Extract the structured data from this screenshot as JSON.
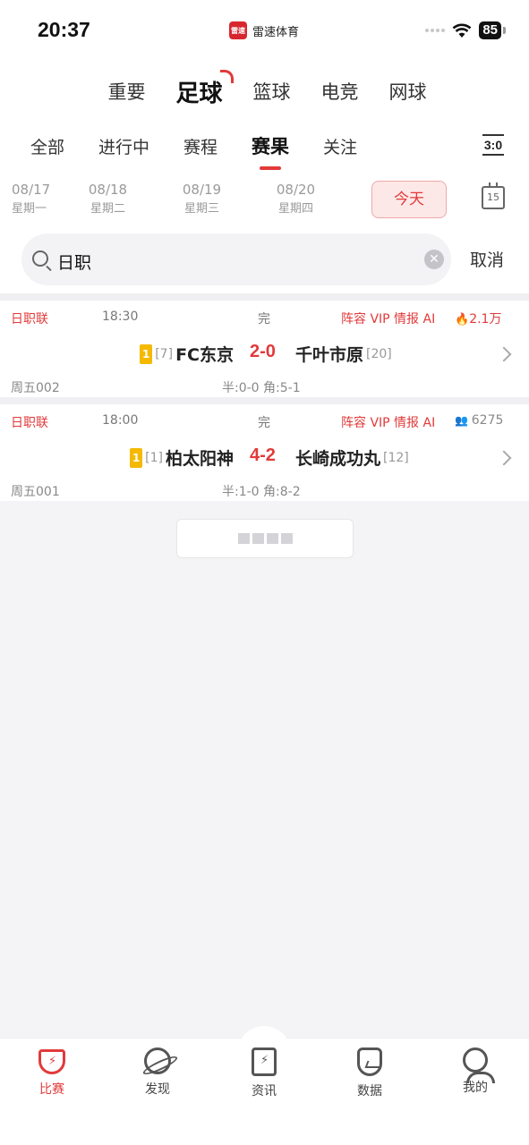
{
  "status_bar": {
    "time": "20:37",
    "app_logo_text": "雷速",
    "app_name": "雷速体育",
    "battery": "85"
  },
  "sport_tabs": [
    {
      "label": "重要"
    },
    {
      "label": "足球",
      "active": true
    },
    {
      "label": "篮球"
    },
    {
      "label": "电竞"
    },
    {
      "label": "网球"
    }
  ],
  "sub_tabs": [
    {
      "label": "全部"
    },
    {
      "label": "进行中"
    },
    {
      "label": "赛程"
    },
    {
      "label": "赛果",
      "active": true
    },
    {
      "label": "关注"
    }
  ],
  "score_icon_text": "3:0",
  "dates": [
    {
      "date": "08/17",
      "weekday": "星期一"
    },
    {
      "date": "08/18",
      "weekday": "星期二"
    },
    {
      "date": "08/19",
      "weekday": "星期三"
    },
    {
      "date": "08/20",
      "weekday": "星期四"
    }
  ],
  "today_label": "今天",
  "calendar_day": "15",
  "search": {
    "value": "日职",
    "cancel_label": "取消"
  },
  "matches": [
    {
      "league": "日职联",
      "time": "18:30",
      "status": "完",
      "info": "阵容 VIP 情报 AI",
      "heat": "2.1万",
      "heat_icon": "flame-icon",
      "badge": "1",
      "home_rank": "[7]",
      "home": "FC东京",
      "score": "2-0",
      "away": "千叶市原",
      "away_rank": "[20]",
      "code": "周五002",
      "half": "半:0-0 角:5-1"
    },
    {
      "league": "日职联",
      "time": "18:00",
      "status": "完",
      "info": "阵容 VIP 情报 AI",
      "heat": "6275",
      "heat_icon": "people-icon",
      "badge": "1",
      "home_rank": "[1]",
      "home": "柏太阳神",
      "score": "4-2",
      "away": "长崎成功丸",
      "away_rank": "[12]",
      "code": "周五001",
      "half": "半:1-0 角:8-2"
    }
  ],
  "bottom_nav": [
    {
      "label": "比赛",
      "icon": "trophy-icon",
      "active": true
    },
    {
      "label": "发现",
      "icon": "planet-icon"
    },
    {
      "label": "资讯",
      "icon": "news-icon"
    },
    {
      "label": "数据",
      "icon": "data-icon"
    },
    {
      "label": "我的",
      "icon": "profile-icon"
    }
  ],
  "colors": {
    "accent": "#e23a3a",
    "badge": "#f5b900",
    "background": "#f4f4f6"
  }
}
